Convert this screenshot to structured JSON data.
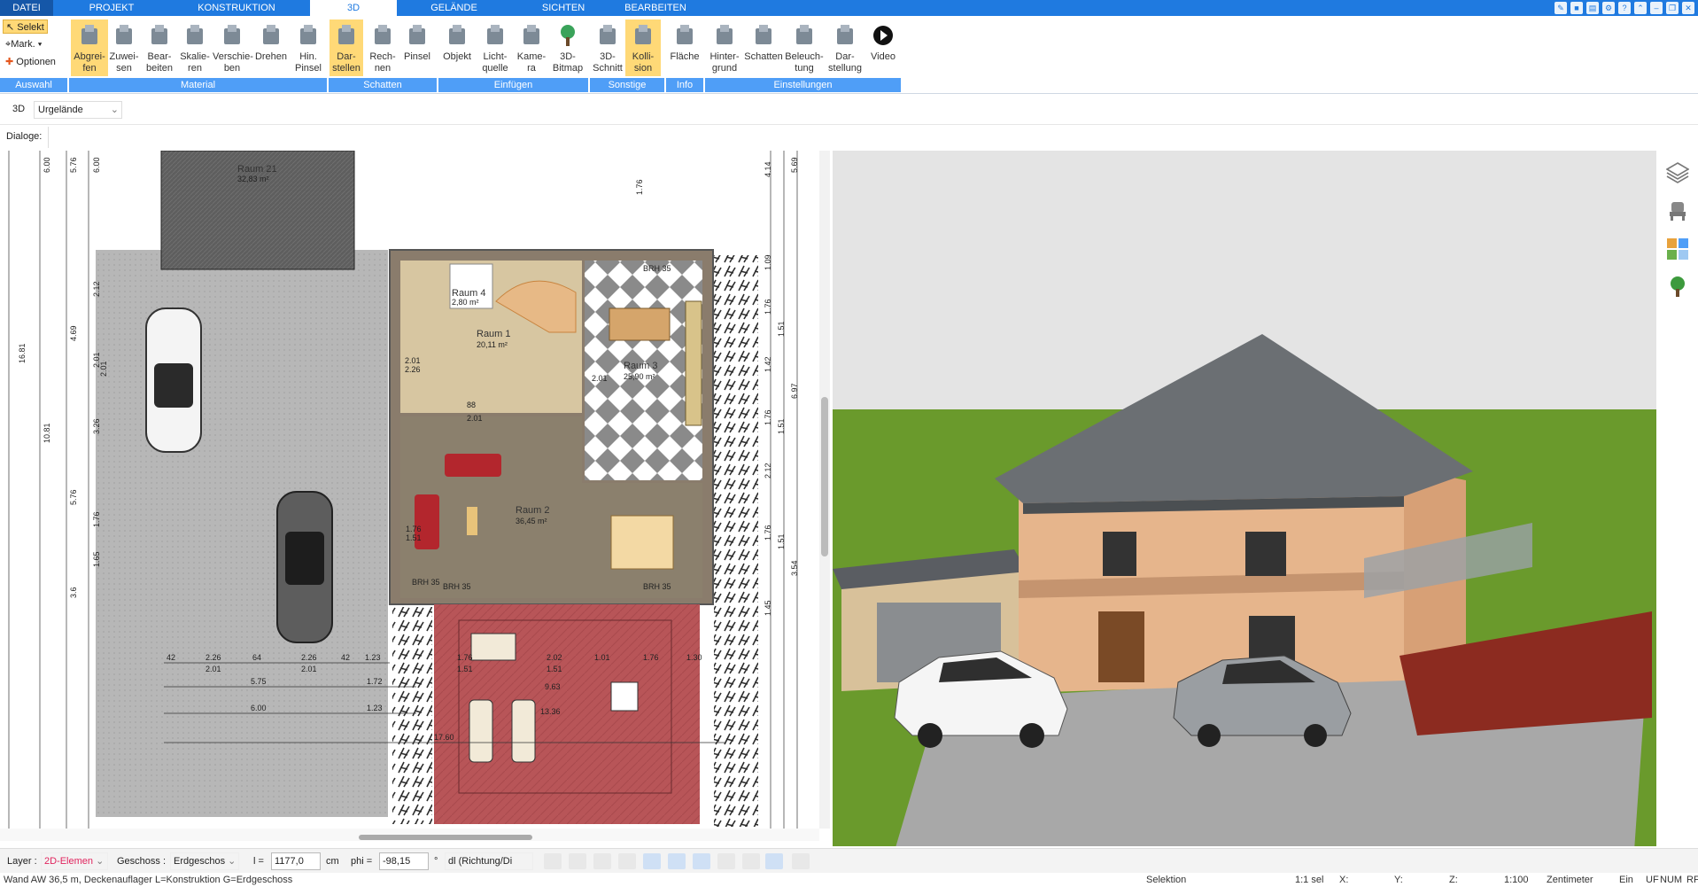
{
  "tabs": {
    "datei": "DATEI",
    "projekt": "PROJEKT",
    "konstruktion": "KONSTRUKTION",
    "dreiD": "3D",
    "gelaende": "GELÄNDE",
    "sichten": "SICHTEN",
    "bearbeiten": "BEARBEITEN"
  },
  "ribbon": {
    "selekt": "Selekt",
    "mark": "Mark.",
    "optionen": "Optionen",
    "buttons": [
      {
        "l1": "Abgrei-",
        "l2": "fen"
      },
      {
        "l1": "Zuwei-",
        "l2": "sen"
      },
      {
        "l1": "Bear-",
        "l2": "beiten"
      },
      {
        "l1": "Skalie-",
        "l2": "ren"
      },
      {
        "l1": "Verschie-",
        "l2": "ben"
      },
      {
        "l1": "Drehen",
        "l2": ""
      },
      {
        "l1": "Hin.",
        "l2": "Pinsel"
      },
      {
        "l1": "Dar-",
        "l2": "stellen"
      },
      {
        "l1": "Rech-",
        "l2": "nen"
      },
      {
        "l1": "Pinsel",
        "l2": ""
      },
      {
        "l1": "Objekt",
        "l2": ""
      },
      {
        "l1": "Licht-",
        "l2": "quelle"
      },
      {
        "l1": "Kame-",
        "l2": "ra"
      },
      {
        "l1": "3D-",
        "l2": "Bitmap"
      },
      {
        "l1": "3D-",
        "l2": "Schnitt"
      },
      {
        "l1": "Kolli-",
        "l2": "sion"
      },
      {
        "l1": "Fläche",
        "l2": ""
      },
      {
        "l1": "Hinter-",
        "l2": "grund"
      },
      {
        "l1": "Schatten",
        "l2": ""
      },
      {
        "l1": "Beleuch-",
        "l2": "tung"
      },
      {
        "l1": "Dar-",
        "l2": "stellung"
      },
      {
        "l1": "Video",
        "l2": ""
      }
    ],
    "groups": {
      "auswahl": "Auswahl",
      "material": "Material",
      "schatten": "Schatten",
      "einfuegen": "Einfügen",
      "sonstige": "Sonstige",
      "info": "Info",
      "einstellungen": "Einstellungen"
    }
  },
  "bar3d": {
    "label": "3D",
    "select": "Urgelände"
  },
  "dialoge": "Dialoge:",
  "plan": {
    "rooms": [
      {
        "name": "Raum 21",
        "area": "32,83 m²"
      },
      {
        "name": "Raum 4",
        "area": "2,80 m²"
      },
      {
        "name": "Raum 1",
        "area": "20,11 m²"
      },
      {
        "name": "Raum 3",
        "area": "25,90 m²"
      },
      {
        "name": "Raum 2",
        "area": "36,45 m²"
      }
    ],
    "dims_left": [
      "6.00",
      "5.76",
      "6.00",
      "2.12",
      "4.69",
      "2.01",
      "2.01",
      "3.26",
      "5.76",
      "1.76",
      "1.65",
      "3.6"
    ],
    "dims_outer_left": [
      "16.81",
      "10.81"
    ],
    "dims_right": [
      "1.76",
      "1.09",
      "1.76",
      "1.51",
      "1.42",
      "6.97",
      "1.76",
      "1.51",
      "2.12",
      "1.76",
      "1.51",
      "3.54",
      "1.45",
      "4.14",
      "5.69"
    ],
    "dims_bottom": [
      "42",
      "2.26",
      "64",
      "2.26",
      "42",
      "1.23",
      "2.01",
      "2.01",
      "5.75",
      "1.72",
      "6.00",
      "1.23",
      "1.76",
      "1.51",
      "2.02",
      "1.51",
      "1.01",
      "1.76",
      "1.30",
      "9.63",
      "13.36",
      "17.60"
    ],
    "misc_labels": [
      "2.01",
      "2.26",
      "88",
      "2.01",
      "2.01",
      "1.76",
      "1.51",
      "BRH 35",
      "BRH 35",
      "BRH 35",
      "BRH 35"
    ]
  },
  "toolbar": {
    "layer_label": "Layer :",
    "layer_value": "2D-Elemen",
    "geschoss_label": "Geschoss :",
    "geschoss_value": "Erdgeschos",
    "l_label": "l =",
    "l_value": "1177,0",
    "l_unit": "cm",
    "phi_label": "phi =",
    "phi_value": "-98,15",
    "phi_unit": "°",
    "dl_value": "dl (Richtung/Di"
  },
  "status": {
    "message": "Wand AW 36,5 m, Deckenauflager L=Konstruktion G=Erdgeschoss",
    "selektion": "Selektion",
    "sel_count": "1:1 sel",
    "x": "X:",
    "y": "Y:",
    "z": "Z:",
    "scale": "1:100",
    "unit": "Zentimeter",
    "ein": "Ein",
    "uf": "UF",
    "num": "NUM",
    "rf": "RF"
  },
  "colors": {
    "tabbar": "#1f7ae0",
    "group": "#4f9ef7",
    "active": "#ffd977",
    "grass": "#6a9a2c"
  }
}
